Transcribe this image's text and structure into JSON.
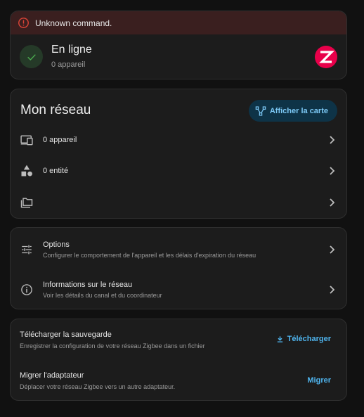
{
  "status_card": {
    "alert_text": "Unknown command.",
    "title": "En ligne",
    "subtitle": "0 appareil",
    "logo_letter": "Z",
    "logo_color": "#e8004a"
  },
  "network_card": {
    "title": "Mon réseau",
    "map_button_label": "Afficher la carte",
    "rows": [
      {
        "label": "0 appareil",
        "icon": "devices-icon"
      },
      {
        "label": "0 entité",
        "icon": "shapes-icon"
      },
      {
        "label": "",
        "icon": "folder-multiple-icon"
      }
    ]
  },
  "config_card": {
    "items": [
      {
        "title": "Options",
        "subtitle": "Configurer le comportement de l'appareil et les délais d'expiration du réseau",
        "icon": "tune-icon"
      },
      {
        "title": "Informations sur le réseau",
        "subtitle": "Voir les détails du canal et du coordinateur",
        "icon": "info-icon"
      }
    ]
  },
  "backup_card": {
    "download": {
      "title": "Télécharger la sauvegarde",
      "subtitle": "Enregistrer la configuration de votre réseau Zigbee dans un fichier",
      "button_label": "Télécharger"
    },
    "migrate": {
      "title": "Migrer l'adaptateur",
      "subtitle": "Déplacer votre réseau Zigbee vers un autre adaptateur.",
      "button_label": "Migrer"
    }
  },
  "colors": {
    "background": "#111111",
    "card": "#1c1c1c",
    "alert_bg": "#3a1f1f",
    "alert_icon": "#db4437",
    "success": "#4caf50",
    "accent": "#4fb5ef"
  }
}
